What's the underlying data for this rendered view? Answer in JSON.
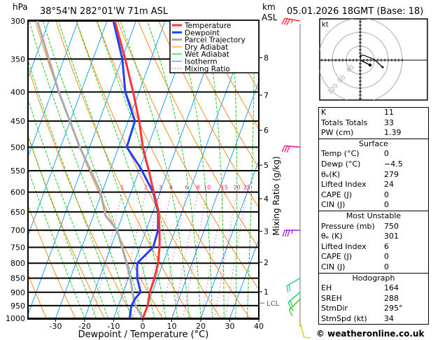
{
  "header": {
    "pressure_unit": "hPa",
    "location": "38°54'N  282°01'W  71m  ASL",
    "height_unit": "km",
    "height_ref": "ASL",
    "datetime": "05.01.2026  18GMT  (Base: 18)"
  },
  "colors": {
    "temperature": "#ff3333",
    "dewpoint": "#2040ff",
    "parcel": "#aaaaaa",
    "dry_adiabat": "#ff8c1a",
    "wet_adiabat": "#22cc22",
    "isotherm": "#1ea0ff",
    "mixing_ratio": "#ff1493"
  },
  "legend": [
    {
      "label": "Temperature",
      "key": "temperature",
      "style": "thick"
    },
    {
      "label": "Dewpoint",
      "key": "dewpoint",
      "style": "thick"
    },
    {
      "label": "Parcel Trajectory",
      "key": "parcel",
      "style": "thick"
    },
    {
      "label": "Dry Adiabat",
      "key": "dry_adiabat",
      "style": "thin"
    },
    {
      "label": "Wet Adiabat",
      "key": "wet_adiabat",
      "style": "thin"
    },
    {
      "label": "Isotherm",
      "key": "isotherm",
      "style": "thin"
    },
    {
      "label": "Mixing Ratio",
      "key": "mixing_ratio",
      "style": "dotted"
    }
  ],
  "chart_data": {
    "type": "line",
    "subtype": "skew-T log-p",
    "xlabel": "Dewpoint / Temperature (°C)",
    "ylabel": "hPa",
    "x_ticks": [
      -30,
      -20,
      -10,
      0,
      10,
      20,
      30,
      40
    ],
    "pressure_levels": [
      300,
      350,
      400,
      450,
      500,
      550,
      600,
      650,
      700,
      750,
      800,
      850,
      900,
      950,
      1000
    ],
    "pressure_range": [
      1000,
      300
    ],
    "height_axis": {
      "label": "Mixing Ratio (g/kg)",
      "ticks": [
        {
          "label": "1",
          "p": 898
        },
        {
          "label": "2",
          "p": 797
        },
        {
          "label": "3",
          "p": 703
        },
        {
          "label": "4",
          "p": 616
        },
        {
          "label": "5",
          "p": 538
        },
        {
          "label": "6",
          "p": 467
        },
        {
          "label": "7",
          "p": 405
        },
        {
          "label": "8",
          "p": 348
        }
      ],
      "lcl": {
        "label": "LCL",
        "p": 940
      }
    },
    "mixing_ratio_labels": [
      "1",
      "2",
      "3",
      "4",
      "6",
      "8",
      "10",
      "15",
      "20",
      "25"
    ],
    "mixing_ratio_values": [
      1,
      2,
      3,
      4,
      6,
      8,
      10,
      15,
      20,
      25
    ],
    "series": [
      {
        "name": "Temperature",
        "key": "temperature",
        "p": [
          1000,
          950,
          900,
          850,
          800,
          750,
          700,
          650,
          600,
          550,
          500,
          450,
          400,
          350,
          300
        ],
        "t": [
          0,
          0.1,
          -0.9,
          -1.0,
          -1.7,
          -3.2,
          -5.4,
          -8.0,
          -12.2,
          -16.6,
          -21.7,
          -26.2,
          -32.0,
          -38.9,
          -47.3
        ]
      },
      {
        "name": "Dewpoint",
        "key": "dewpoint",
        "p": [
          1000,
          950,
          920,
          900,
          850,
          800,
          750,
          700,
          650,
          600,
          545,
          500,
          450,
          400,
          350,
          300
        ],
        "t": [
          -4.5,
          -5.5,
          -5.0,
          -4.0,
          -7.0,
          -8.9,
          -5.4,
          -5.9,
          -8.2,
          -12.4,
          -19.7,
          -27.2,
          -27.7,
          -34.7,
          -39.9,
          -47.8
        ]
      },
      {
        "name": "Parcel Trajectory",
        "key": "parcel",
        "p": [
          1000,
          940,
          900,
          850,
          800,
          700,
          660,
          600,
          500,
          400,
          300
        ],
        "t": [
          0,
          -4.8,
          -6.8,
          -9.4,
          -12.5,
          -20.0,
          -25.8,
          -30.5,
          -43.4,
          -57.6,
          -74.0
        ]
      }
    ],
    "wind_barbs": [
      {
        "p": 300,
        "dir": 280,
        "speed": 35,
        "color": "#ff2020"
      },
      {
        "p": 500,
        "dir": 275,
        "speed": 30,
        "color": "#ff1480"
      },
      {
        "p": 700,
        "dir": 270,
        "speed": 35,
        "color": "#9a20e0"
      },
      {
        "p": 850,
        "dir": 240,
        "speed": 20,
        "color": "#20d0a0"
      },
      {
        "p": 900,
        "dir": 230,
        "speed": 20,
        "color": "#20d070"
      },
      {
        "p": 925,
        "dir": 225,
        "speed": 15,
        "color": "#30d020"
      },
      {
        "p": 1000,
        "dir": 165,
        "speed": 10,
        "color": "#e0d020"
      }
    ]
  },
  "hodograph": {
    "unit_label": "kt",
    "rings": [
      40,
      80,
      120
    ],
    "ring_labels": [
      "40",
      "80",
      "120"
    ],
    "points_uv": [
      [
        0,
        0
      ],
      [
        2,
        14
      ],
      [
        10,
        14
      ],
      [
        40,
        2
      ],
      [
        64,
        -20
      ]
    ],
    "storm_motion_uv": [
      28,
      -14
    ]
  },
  "panel": {
    "indices": [
      {
        "k": "K",
        "v": "11"
      },
      {
        "k": "Totals Totals",
        "v": "33"
      },
      {
        "k": "PW (cm)",
        "v": "1.39"
      }
    ],
    "surface": {
      "title": "Surface",
      "rows": [
        {
          "k": "Temp (°C)",
          "v": "0"
        },
        {
          "k": "Dewp (°C)",
          "v": "−4.5"
        },
        {
          "k": "θₑ(K)",
          "v": "279"
        },
        {
          "k": "Lifted Index",
          "v": "24"
        },
        {
          "k": "CAPE (J)",
          "v": "0"
        },
        {
          "k": "CIN (J)",
          "v": "0"
        }
      ]
    },
    "most_unstable": {
      "title": "Most Unstable",
      "rows": [
        {
          "k": "Pressure (mb)",
          "v": "750"
        },
        {
          "k": "θₑ (K)",
          "v": "301"
        },
        {
          "k": "Lifted Index",
          "v": "6"
        },
        {
          "k": "CAPE (J)",
          "v": "0"
        },
        {
          "k": "CIN (J)",
          "v": "0"
        }
      ]
    },
    "hodograph": {
      "title": "Hodograph",
      "rows": [
        {
          "k": "EH",
          "v": "164"
        },
        {
          "k": "SREH",
          "v": "288"
        },
        {
          "k": "StmDir",
          "v": "295°"
        },
        {
          "k": "StmSpd (kt)",
          "v": "34"
        }
      ]
    }
  },
  "copyright": "© weatheronline.co.uk"
}
